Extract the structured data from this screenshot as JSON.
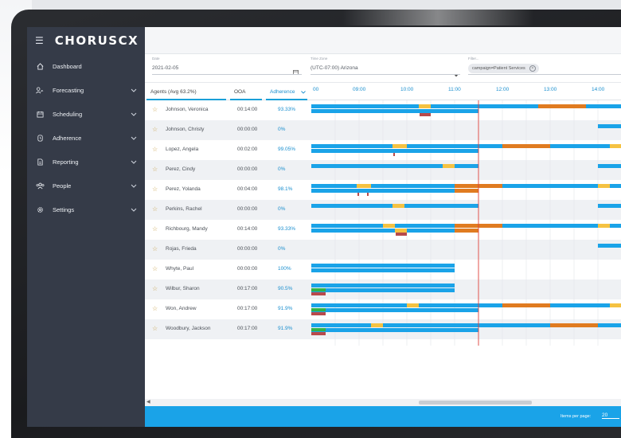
{
  "brand": {
    "logo": "CHORUSCX"
  },
  "sidebar": {
    "items": [
      {
        "label": "Dashboard",
        "icon": "home-icon",
        "expandable": false
      },
      {
        "label": "Forecasting",
        "icon": "users-chart-icon",
        "expandable": true
      },
      {
        "label": "Scheduling",
        "icon": "calendar-icon",
        "expandable": true
      },
      {
        "label": "Adherence",
        "icon": "clock-icon",
        "expandable": true
      },
      {
        "label": "Reporting",
        "icon": "report-icon",
        "expandable": true
      },
      {
        "label": "People",
        "icon": "people-icon",
        "expandable": true
      },
      {
        "label": "Settings",
        "icon": "gear-icon",
        "expandable": true
      }
    ]
  },
  "filters": {
    "date_label": "Date",
    "date_value": "2021-02-05",
    "timezone_label": "Time Zone",
    "timezone_value": "(UTC-07:00) Arizona",
    "filter_label": "Filter...",
    "filter_chip": "campaign=Patient Services"
  },
  "table": {
    "columns": {
      "agents": "Agents (Avg 63.2%)",
      "ooa": "OOA",
      "adherence": "Adherence"
    },
    "hours": [
      "00",
      "09:00",
      "10:00",
      "11:00",
      "12:00",
      "13:00",
      "14:00"
    ],
    "rows": [
      {
        "name": "Johnson, Veronica",
        "ooa": "00:14:00",
        "adherence": "93.33%"
      },
      {
        "name": "Johnson, Christy",
        "ooa": "00:00:00",
        "adherence": "0%"
      },
      {
        "name": "Lopez, Angela",
        "ooa": "00:02:00",
        "adherence": "99.05%"
      },
      {
        "name": "Perez, Cindy",
        "ooa": "00:00:00",
        "adherence": "0%"
      },
      {
        "name": "Perez, Yolanda",
        "ooa": "00:04:00",
        "adherence": "98.1%"
      },
      {
        "name": "Perkins, Rachel",
        "ooa": "00:00:00",
        "adherence": "0%"
      },
      {
        "name": "Richbourg, Mandy",
        "ooa": "00:14:00",
        "adherence": "93.33%"
      },
      {
        "name": "Rojas, Frieda",
        "ooa": "00:00:00",
        "adherence": "0%"
      },
      {
        "name": "Whyte, Paul",
        "ooa": "00:00:00",
        "adherence": "100%"
      },
      {
        "name": "Wilbur, Sharon",
        "ooa": "00:17:00",
        "adherence": "90.5%"
      },
      {
        "name": "Won, Andrew",
        "ooa": "00:17:00",
        "adherence": "91.9%"
      },
      {
        "name": "Woodbury, Jackson",
        "ooa": "00:17:00",
        "adherence": "91.9%"
      }
    ]
  },
  "footer": {
    "items_per_page_label": "Items per page:",
    "items_per_page_value": "20"
  },
  "colors": {
    "accent": "#1aa3e8",
    "sidebar": "#353b48",
    "break": "#f5c242",
    "shift_alt": "#e07b20",
    "exception": "#b84a4a",
    "in_adherence": "#33b24a",
    "now_line": "#e0413b"
  }
}
